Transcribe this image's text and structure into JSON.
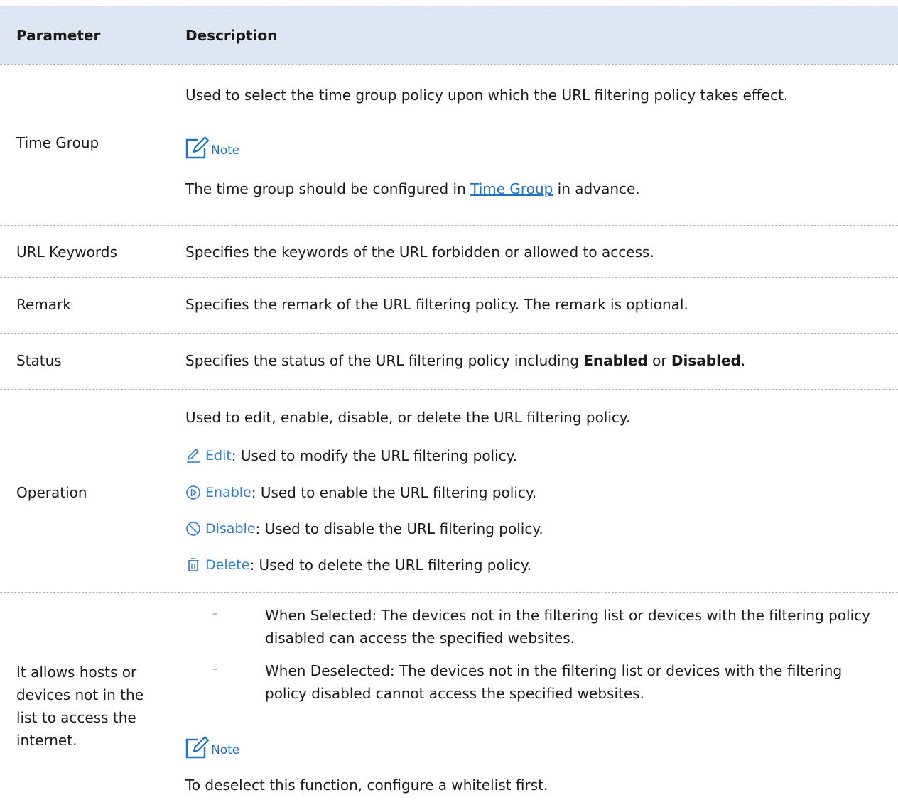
{
  "header": {
    "param": "Parameter",
    "desc": "Description"
  },
  "time_group": {
    "name": "Time Group",
    "desc": "Used to select the time group policy upon which the URL filtering policy takes effect.",
    "note_label": "Note",
    "note_pre": "The time group should be configured in ",
    "note_link": "Time Group",
    "note_post": " in advance."
  },
  "url_keywords": {
    "name": "URL Keywords",
    "desc": "Specifies the keywords of the URL forbidden or allowed to access."
  },
  "remark": {
    "name": "Remark",
    "desc": "Specifies the remark of the URL filtering policy. The remark is optional."
  },
  "status": {
    "name": "Status",
    "desc_pre": "Specifies the status of the URL filtering policy including ",
    "enabled": "Enabled",
    "or": " or ",
    "disabled": "Disabled",
    "end": "."
  },
  "operation": {
    "name": "Operation",
    "desc": "Used to edit, enable, disable, or delete the URL filtering policy.",
    "edit_label": "Edit",
    "edit_desc": ": Used to modify the URL filtering policy.",
    "enable_label": "Enable",
    "enable_desc": ": Used to enable the URL filtering policy.",
    "disable_label": "Disable",
    "disable_desc": ": Used to disable the URL filtering policy.",
    "delete_label": "Delete",
    "delete_desc": ": Used to delete the URL filtering policy."
  },
  "allow": {
    "name": "It allows hosts or devices not in the list to access the internet.",
    "bullet_mark": "–",
    "selected": "When Selected: The devices not in the filtering list or devices with the filtering policy disabled can access the specified websites.",
    "deselected": "When Deselected: The devices not in the filtering list or devices with the filtering policy disabled cannot access the specified websites.",
    "note_label": "Note",
    "note": "To deselect this function, configure a whitelist first."
  },
  "colors": {
    "header_bg": "#dde6f2",
    "link": "#1a73c6",
    "op_blue": "#2f7fd0"
  }
}
